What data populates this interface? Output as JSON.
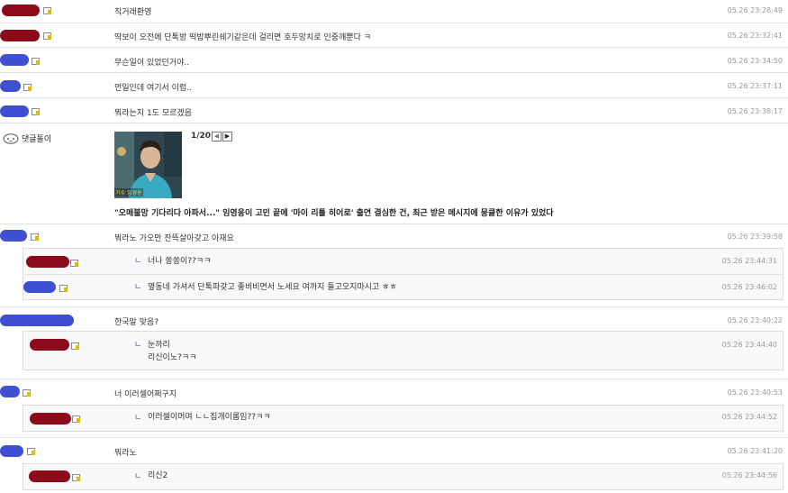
{
  "colors": {
    "maroon": "#8b0a1a",
    "blue": "#3f4fd1",
    "reply_arrow": "#3b5ba5"
  },
  "comments": [
    {
      "text": "직거래환영",
      "time": "05.26 23:28:49",
      "nick_color": "maroon"
    },
    {
      "text": "딱보이 오전에 단톡방 떡밥뿌린쉐기같은데 걸리면 호두망치로 인중깨뿐다 ㅋ",
      "time": "05.26 23:32:41",
      "nick_color": "maroon"
    },
    {
      "text": "무슨일이 있었던거야..",
      "time": "05.26 23:34:50",
      "nick_color": "blue"
    },
    {
      "text": "먼일인데 여기서 이럼..",
      "time": "05.26 23:37:11",
      "nick_color": "blue"
    },
    {
      "text": "뭐라는지 1도 모르겠음",
      "time": "05.26 23:38:17",
      "nick_color": "blue"
    }
  ],
  "bot": {
    "name": "댓글돌이",
    "pager": "1/20",
    "prev_icon": "chevron-left-icon",
    "next_icon": "chevron-right-icon",
    "thumbnail_caption": "가수 임영웅",
    "headline": "\"오매불망 기다리다 아파서...\" 임영웅이 고민 끝에 '마이 리틀 히어로' 출연 결심한 건, 최근 받은 메시지에 뭉클한 이유가 있었다"
  },
  "threads": [
    {
      "text": "뭐라노 가오만 잔뜩살아갖고 아재요",
      "time": "05.26 23:39:58",
      "nick_color": "blue",
      "replies": [
        {
          "arrow": "ㄴ",
          "lines": [
            "너나 쏭쏭이??ㅋㅋ"
          ],
          "time": "05.26 23:44:31",
          "nick_color": "maroon"
        },
        {
          "arrow": "ㄴ",
          "lines": [
            "옆동네 가셔서 단톡파갖고 좋비비면서 노세요 여까지 들고오지마시고 ㅎㅎ"
          ],
          "time": "05.26 23:46:02",
          "nick_color": "blue"
        }
      ]
    },
    {
      "text": "한국말 맞음?",
      "time": "05.26 23:40:22",
      "nick_color": "blue",
      "replies": [
        {
          "arrow": "ㄴ",
          "lines": [
            "눈까리",
            "리신이노?ㅋㅋ"
          ],
          "time": "05.26 23:44:40",
          "nick_color": "maroon"
        }
      ]
    },
    {
      "text": "너 이러셀어쩌구지",
      "time": "05.26 23:40:53",
      "nick_color": "blue",
      "replies": [
        {
          "arrow": "ㄴ",
          "lines": [
            "이러셀이머여 ㄴㄴ집개이롬임??ㅋㅋ"
          ],
          "time": "05.26 23:44:52",
          "nick_color": "maroon"
        }
      ]
    },
    {
      "text": "뭐라노",
      "time": "05.26 23:41:20",
      "nick_color": "blue",
      "replies": [
        {
          "arrow": "ㄴ",
          "lines": [
            "리신2"
          ],
          "time": "05.26 23:44:56",
          "nick_color": "maroon"
        }
      ]
    }
  ]
}
